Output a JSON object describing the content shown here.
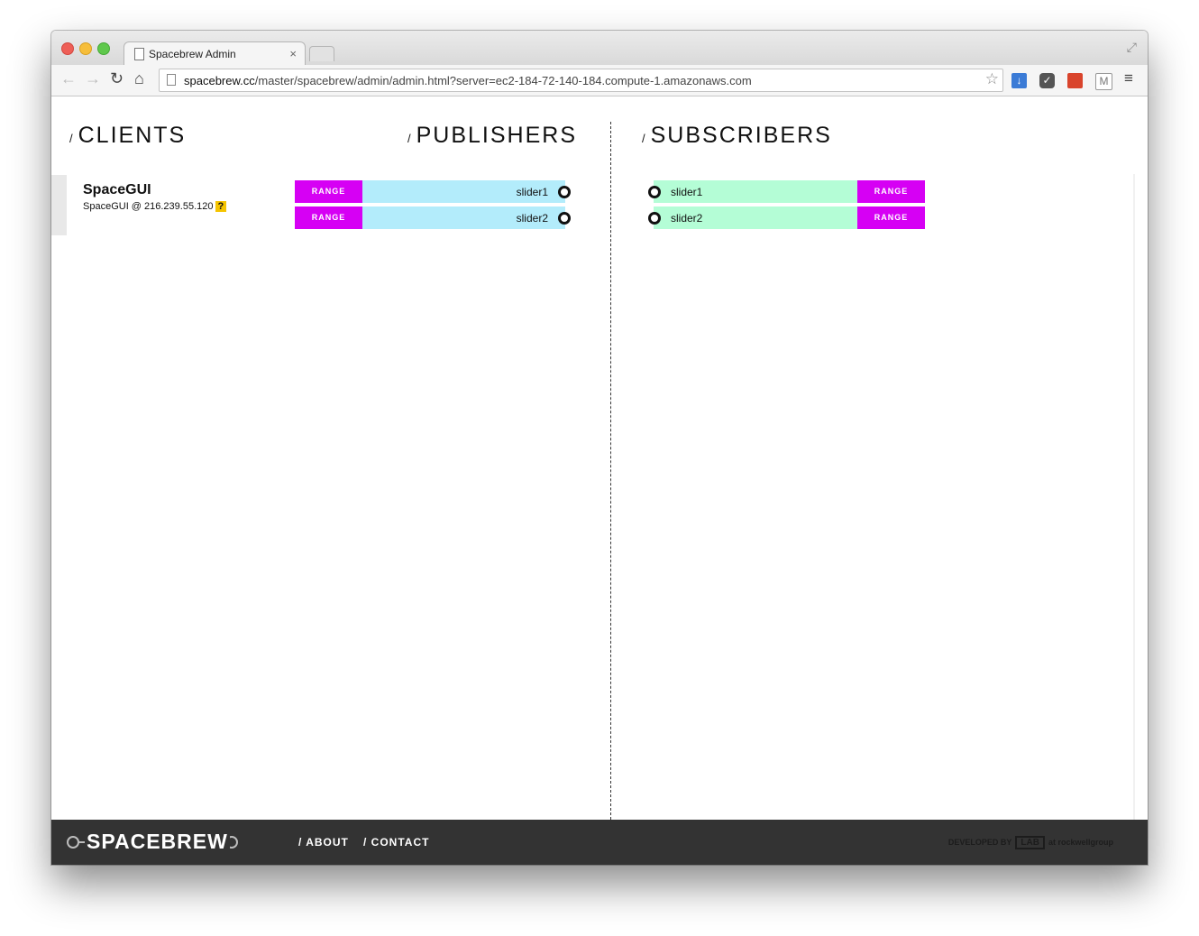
{
  "browser": {
    "tab_title": "Spacebrew Admin",
    "tab_close": "×",
    "url_host": "spacebrew.cc",
    "url_path": "/master/spacebrew/admin/admin.html?server=ec2-184-72-140-184.compute-1.amazonaws.com",
    "back_glyph": "←",
    "forward_glyph": "→",
    "reload_glyph": "↻",
    "home_glyph": "⌂",
    "star_glyph": "☆",
    "menu_glyph": "≡",
    "fullscreen_glyph": "⤢"
  },
  "headings": {
    "slash": "/",
    "clients": "CLIENTS",
    "publishers": "PUBLISHERS",
    "subscribers": "SUBSCRIBERS"
  },
  "client": {
    "name": "SpaceGUI",
    "address": "SpaceGUI @ 216.239.55.120",
    "help": "?"
  },
  "publishers": [
    {
      "type": "RANGE",
      "name": "slider1"
    },
    {
      "type": "RANGE",
      "name": "slider2"
    }
  ],
  "subscribers": [
    {
      "type": "RANGE",
      "name": "slider1"
    },
    {
      "type": "RANGE",
      "name": "slider2"
    }
  ],
  "footer": {
    "logo": "SPACEBREW",
    "about": "/  ABOUT",
    "contact": "/  CONTACT",
    "developed_by": "DEVELOPED BY",
    "lab": "LAB",
    "at": "at rockwellgroup"
  },
  "colors": {
    "type_button": "#d600f4",
    "publisher_bar": "#b3ecfb",
    "subscriber_bar": "#b4fdd6",
    "help_badge": "#f5c400",
    "footer_bg": "#333333"
  }
}
